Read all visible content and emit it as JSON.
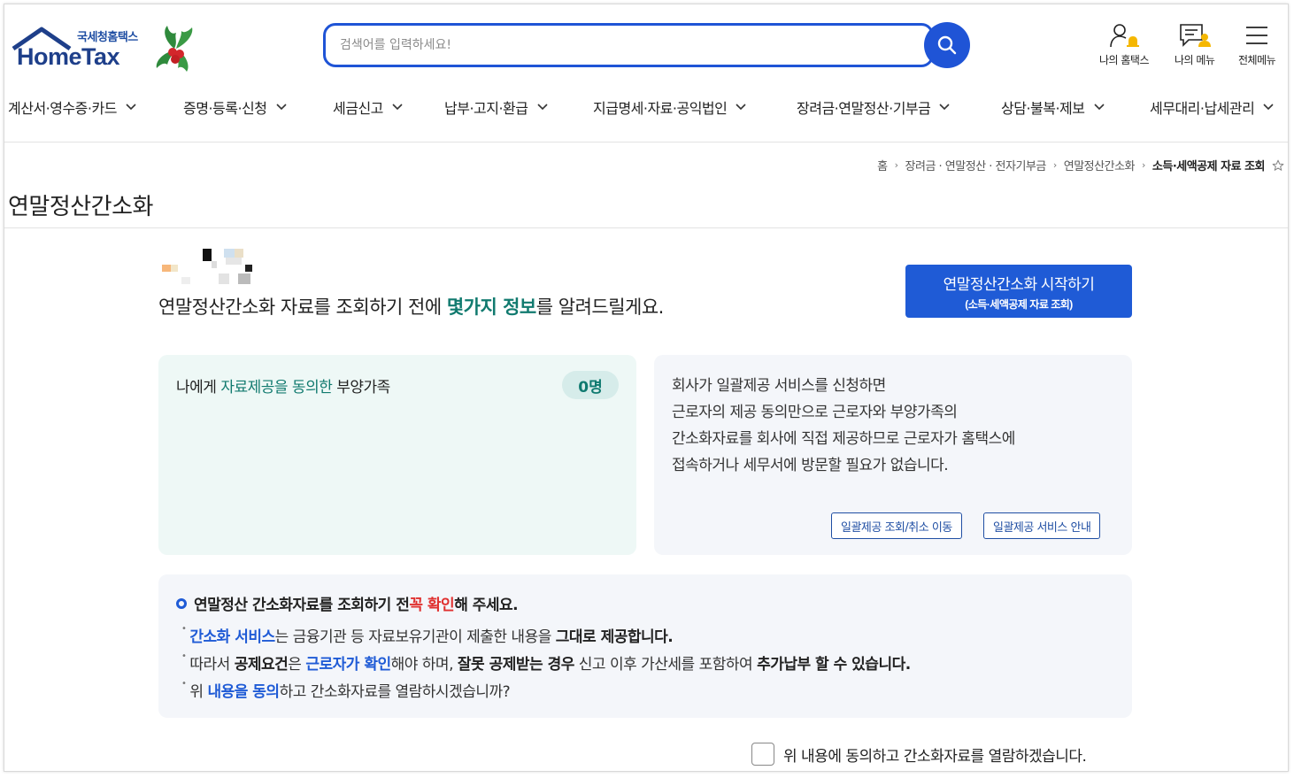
{
  "logo": {
    "sub": "국세청홈택스",
    "main": "HomeTax"
  },
  "search": {
    "placeholder": "검색어를 입력하세요!"
  },
  "top_menu": [
    {
      "label": "나의 홈택스",
      "icon": "user-bell-icon"
    },
    {
      "label": "나의 메뉴",
      "icon": "my-menu-icon"
    },
    {
      "label": "전체메뉴",
      "icon": "hamburger-icon"
    }
  ],
  "nav": [
    "계산서·영수증·카드",
    "증명·등록·신청",
    "세금신고",
    "납부·고지·환급",
    "지급명세·자료·공익법인",
    "장려금·연말정산·기부금",
    "상담·불복·제보",
    "세무대리·납세관리"
  ],
  "breadcrumb": {
    "items": [
      "홈",
      "장려금 · 연말정산 · 전자기부금",
      "연말정산간소화"
    ],
    "current": "소득·세액공제 자료 조회"
  },
  "page_title": "연말정산간소화",
  "intro": {
    "before": "연말정산간소화 자료를 조회하기 전에 ",
    "highlight": "몇가지 정보",
    "after": "를 알려드릴게요."
  },
  "start_button": {
    "label": "연말정산간소화 시작하기",
    "sub": "(소득·세액공제 자료 조회)"
  },
  "dependents": {
    "before": "나에게 ",
    "highlight": "자료제공을 동의한",
    "after": " 부양가족",
    "count": "0명"
  },
  "bulk_service": {
    "lines": [
      "회사가 일괄제공 서비스를 신청하면",
      "근로자의 제공 동의만으로 근로자와 부양가족의",
      "간소화자료를 회사에 직접 제공하므로 근로자가 홈택스에",
      "접속하거나 세무서에 방문할 필요가 없습니다."
    ],
    "btn_query": "일괄제공 조회/취소 이동",
    "btn_guide": "일괄제공 서비스 안내"
  },
  "notice": {
    "head_a": "연말정산 간소화자료를 조회하기 전 ",
    "head_red": "꼭 확인",
    "head_b": "해 주세요.",
    "l1_blue": "간소화 서비스",
    "l1_a": "는 금융기관 등 자료보유기관이 제출한 내용을 ",
    "l1_bold": "그대로 제공합니다.",
    "l2_a": "따라서 ",
    "l2_bold1": "공제요건",
    "l2_b": "은 ",
    "l2_blue": "근로자가 확인",
    "l2_c": "해야 하며, ",
    "l2_bold2": "잘못 공제받는 경우",
    "l2_d": " 신고 이후 가산세를 포함하여 ",
    "l2_bold3": "추가납부 할 수 있습니다.",
    "l3_a": "위 ",
    "l3_blue": "내용을 동의",
    "l3_b": "하고 간소화자료를 열람하시겠습니까?"
  },
  "agree_label": "위 내용에 동의하고 간소화자료를 열람하겠습니다.",
  "colors": {
    "primary": "#1f5bd6",
    "teal": "#117a6f",
    "red": "#e0302f"
  }
}
